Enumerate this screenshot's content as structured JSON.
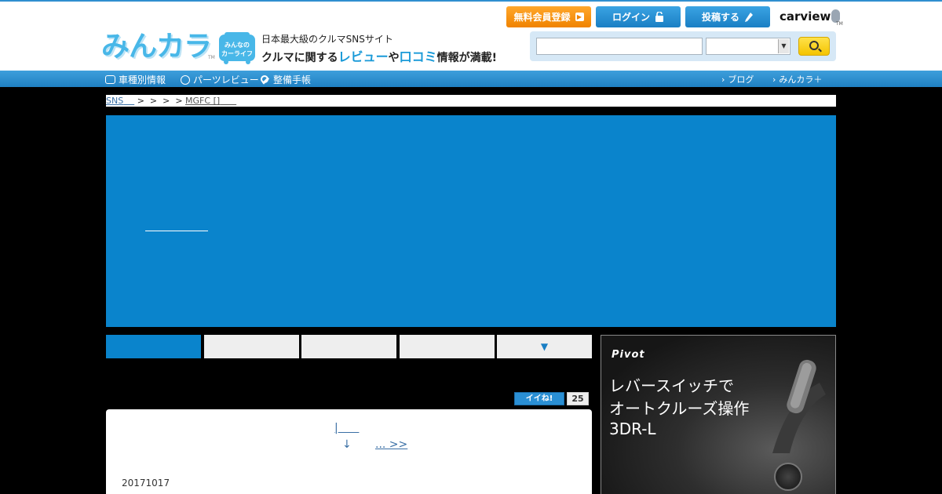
{
  "header": {
    "logo_text": "みんカラ",
    "logo_tm": "TM",
    "badge_line1": "みんなの",
    "badge_line2": "カーライフ",
    "tagline_top": "日本最大級のクルマSNSサイト",
    "tagline_pre": "クルマに関する",
    "tagline_review": "レビュー",
    "tagline_mid": "や",
    "tagline_kuchikomi": "口コミ",
    "tagline_post": "情報が満載!",
    "register_label": "無料会員登録",
    "login_label": "ログイン",
    "post_label": "投稿する",
    "carview_label": "carview",
    "carview_tm": "TM"
  },
  "search": {
    "input_value": "",
    "select_value": ""
  },
  "nav": {
    "car_label": "車種別情報",
    "parts_label": "パーツレビュー",
    "maint_label": "整備手帳",
    "blog_label": "ブログ",
    "plus_label": "みんカラ＋"
  },
  "breadcrumb": {
    "first": "SNS",
    "separators": " >  >  >  > ",
    "last": "MGFC []"
  },
  "tabs": {
    "more_label": "▼"
  },
  "iine": {
    "label": "イイね!",
    "count": "25"
  },
  "content": {
    "prev_link": "|",
    "next_arrow": "↓",
    "next_link": "... >>",
    "date": "20171017"
  },
  "ad": {
    "brand": "Pivot",
    "line1": "レバースイッチで",
    "line2": "オートクルーズ操作",
    "line3": "3DR-L"
  },
  "colors": {
    "brand_blue": "#0a84cc",
    "nav_blue": "#2f8fd0",
    "register_orange": "#f08300",
    "search_yellow": "#f4c400"
  }
}
